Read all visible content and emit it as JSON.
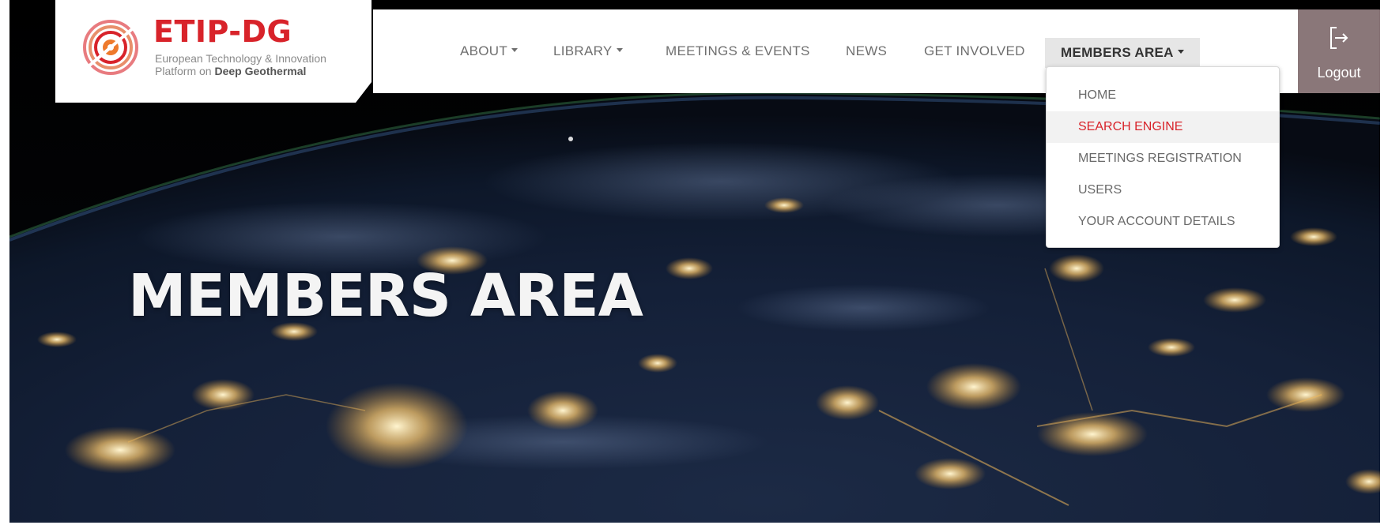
{
  "logo": {
    "title": "ETIP-DG",
    "subtitle_line1": "European Technology & Innovation",
    "subtitle_line2_prefix": "Platform on ",
    "subtitle_line2_bold": "Deep Geothermal"
  },
  "nav": {
    "items": [
      {
        "label": "ABOUT",
        "has_caret": true
      },
      {
        "label": "LIBRARY",
        "has_caret": true
      },
      {
        "label": "MEETINGS & EVENTS",
        "has_caret": false
      },
      {
        "label": "NEWS",
        "has_caret": false
      },
      {
        "label": "GET INVOLVED",
        "has_caret": false
      },
      {
        "label": "MEMBERS AREA",
        "has_caret": true,
        "active": true
      }
    ]
  },
  "logout": {
    "label": "Logout",
    "icon": "logout-icon"
  },
  "dropdown": {
    "items": [
      {
        "label": "HOME"
      },
      {
        "label": "SEARCH ENGINE",
        "highlighted": true
      },
      {
        "label": "MEETINGS REGISTRATION"
      },
      {
        "label": "USERS"
      },
      {
        "label": "YOUR ACCOUNT DETAILS"
      }
    ]
  },
  "hero": {
    "title": "MEMBERS AREA"
  },
  "colors": {
    "brand_red": "#d8232a",
    "logout_bg": "#8a7779",
    "nav_text": "#6f6f6f",
    "active_bg": "#e6e6e6"
  }
}
